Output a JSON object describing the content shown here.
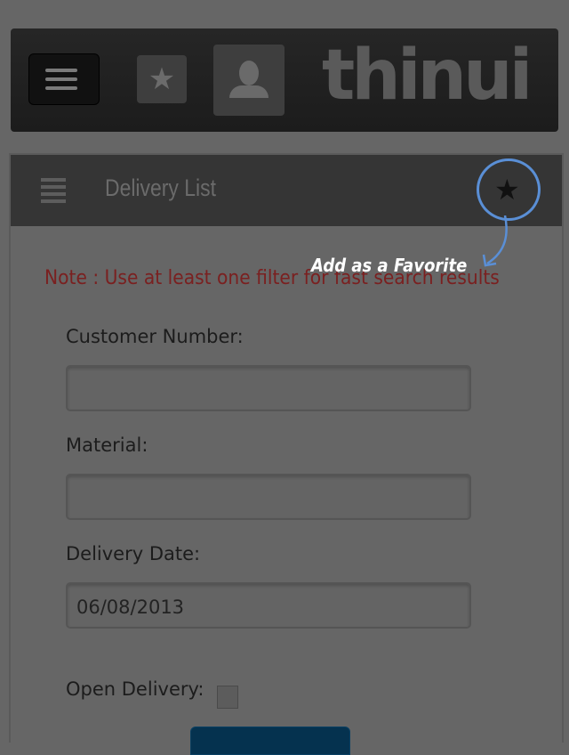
{
  "topbar": {
    "menu_icon": "hamburger-icon",
    "favorite_icon": "star-icon",
    "user_icon": "user-icon",
    "logo": "thinui"
  },
  "panel": {
    "title": "Delivery List",
    "list_icon": "list-icon",
    "favorite_icon": "star-icon",
    "note": "Note : Use at least one filter for fast search results"
  },
  "form": {
    "customer_number": {
      "label": "Customer Number:",
      "value": ""
    },
    "material": {
      "label": "Material:",
      "value": ""
    },
    "delivery_date": {
      "label": "Delivery Date:",
      "value": "06/08/2013"
    },
    "open_delivery": {
      "label": "Open Delivery:",
      "checked": false
    }
  },
  "annotation": {
    "text": "Add as a Favorite",
    "color": "#5a8fd6"
  },
  "colors": {
    "note": "#7a2020",
    "submit": "#05324f"
  }
}
